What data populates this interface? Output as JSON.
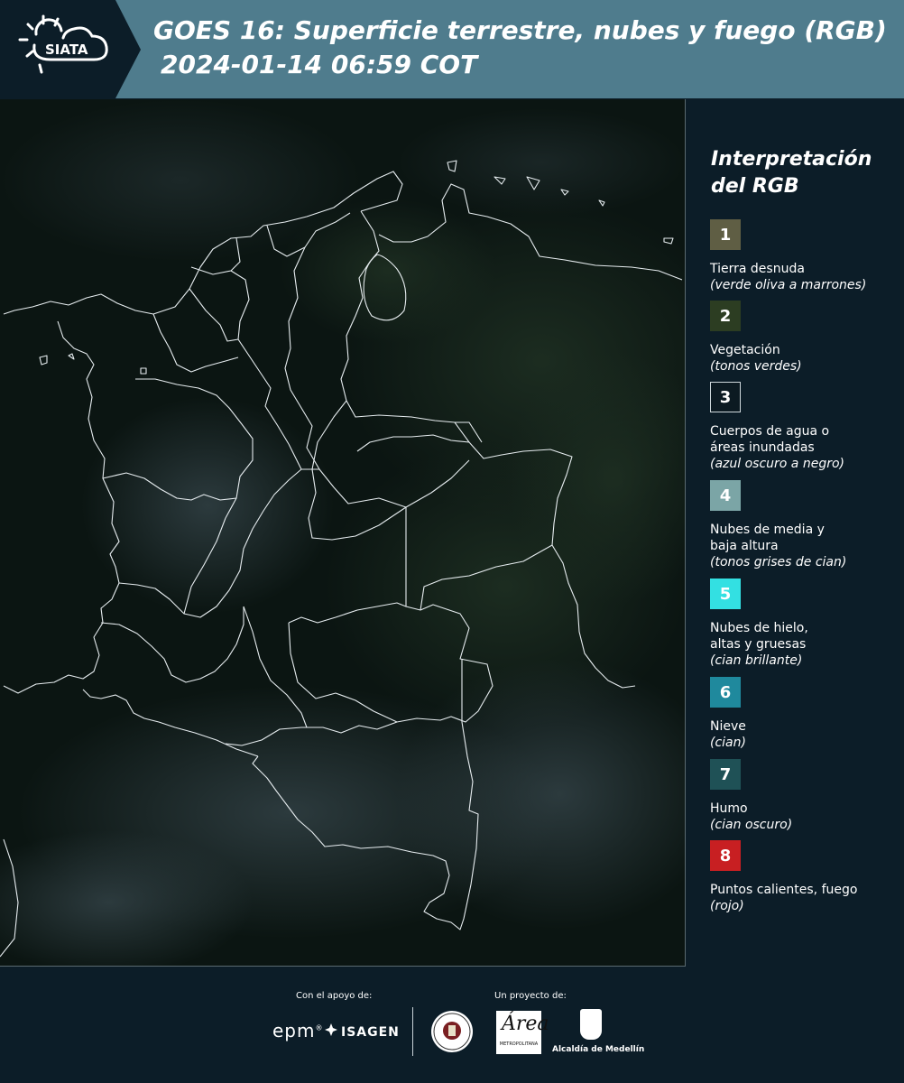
{
  "header": {
    "logo_label": "SIATA",
    "title_line1": "GOES 16: Superficie terrestre, nubes y fuego (RGB)",
    "title_line2": "2024-01-14 06:59 COT"
  },
  "colors": {
    "header_bg": "#4f7c8d",
    "page_bg": "#0c1d28",
    "map_bg": "#0b1512",
    "boundary": "#e6ecef"
  },
  "legend": {
    "title": "Interpretación del RGB",
    "items": [
      {
        "number": "1",
        "label": "Tierra desnuda",
        "note": "(verde oliva a marrones)",
        "color": "#5f5e44"
      },
      {
        "number": "2",
        "label": "Vegetación",
        "note": "(tonos verdes)",
        "color": "#2c3d22"
      },
      {
        "number": "3",
        "label": "Cuerpos de agua o\náreas inundadas",
        "note": "(azul oscuro a negro)",
        "color": "#0c1a22"
      },
      {
        "number": "4",
        "label": "Nubes de media y\nbaja altura",
        "note": "(tonos grises de cian)",
        "color": "#7ba5a6"
      },
      {
        "number": "5",
        "label": "Nubes de hielo,\naltas y gruesas",
        "note": "(cian brillante)",
        "color": "#33e0e2"
      },
      {
        "number": "6",
        "label": "Nieve",
        "note": "(cian)",
        "color": "#1f899d"
      },
      {
        "number": "7",
        "label": "Humo",
        "note": "(cian oscuro)",
        "color": "#1f5156"
      },
      {
        "number": "8",
        "label": "Puntos calientes, fuego",
        "note": "(rojo)",
        "color": "#c81f22"
      }
    ]
  },
  "footer": {
    "support_caption": "Con el apoyo de:",
    "project_caption": "Un proyecto de:",
    "epm": "epm",
    "epm_mark": "®",
    "isagen": "ISAGEN",
    "area_letter": "Área",
    "area_text": "METROPOLITANA",
    "alcaldia": "Alcaldía de Medellín"
  }
}
